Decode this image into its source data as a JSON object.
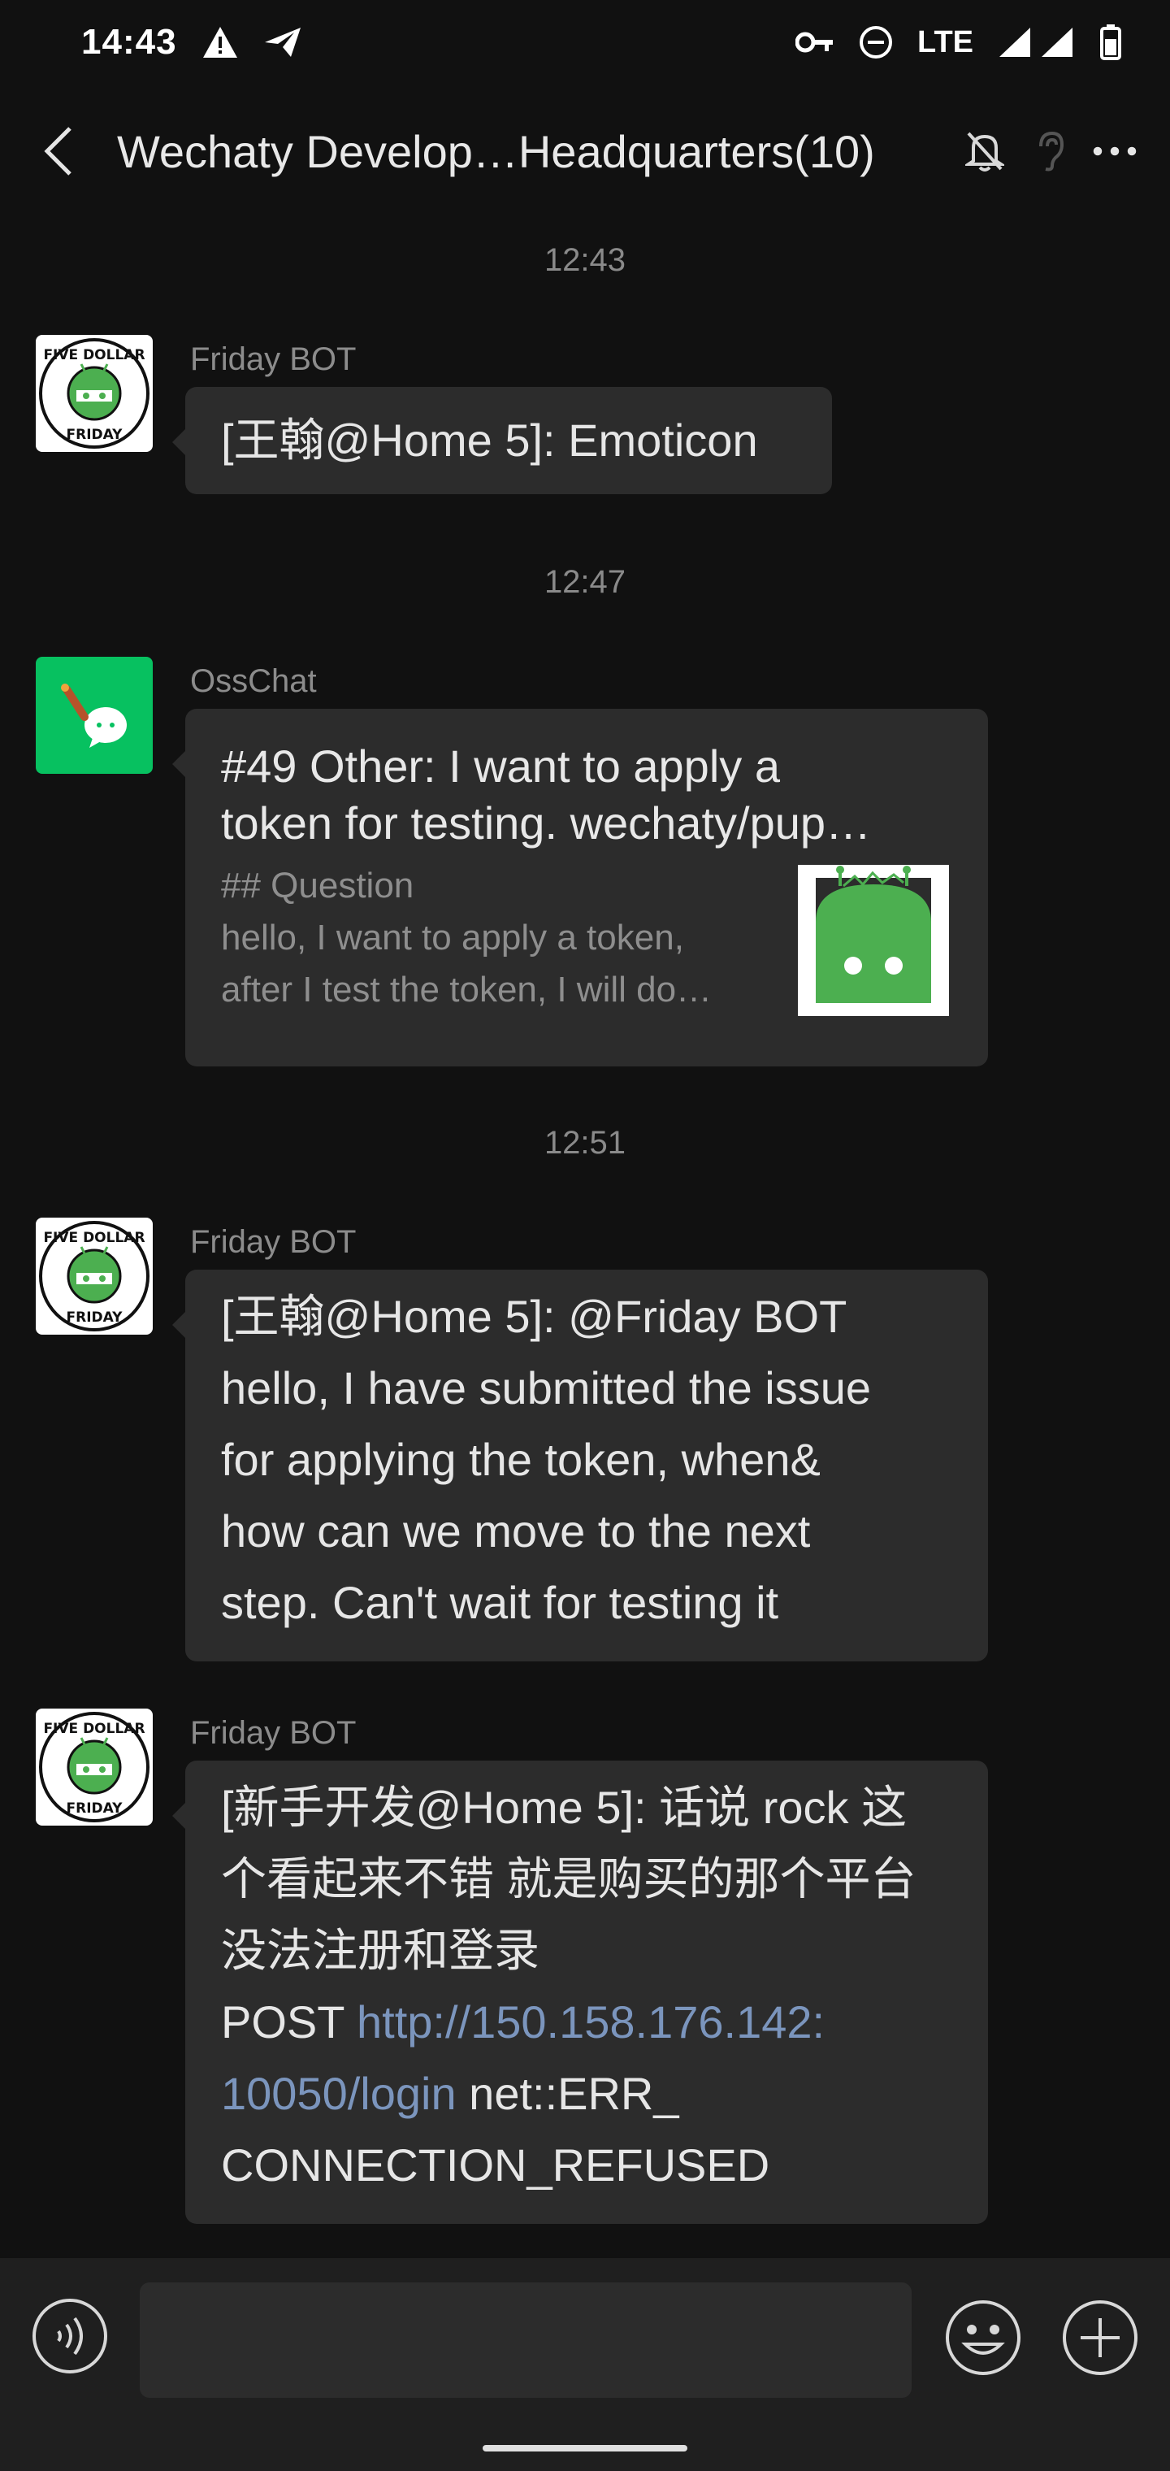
{
  "status_bar": {
    "time": "14:43",
    "network": "LTE",
    "left_icons": [
      "warning-icon",
      "send-icon"
    ],
    "right_icons": [
      "vpn-key-icon",
      "do-not-disturb-icon",
      "signal-icon",
      "battery-icon"
    ]
  },
  "header": {
    "title": "Wechaty Develop…Headquarters(10)",
    "icons": [
      "back-arrow-icon",
      "mute-bell-icon",
      "ear-icon",
      "more-icon"
    ]
  },
  "messages": [
    {
      "type": "timestamp",
      "text": "12:43"
    },
    {
      "type": "text",
      "sender": "Friday BOT",
      "avatar": "five-dollar-friday-avatar",
      "lines": [
        "[王翰@Home 5]: Emoticon"
      ]
    },
    {
      "type": "timestamp",
      "text": "12:47"
    },
    {
      "type": "link_card",
      "sender": "OssChat",
      "avatar": "osschat-avatar",
      "title_lines": [
        "#49 Other:  I want to apply a",
        "token for testing. wechaty/pup…"
      ],
      "heading": "## Question",
      "desc_lines": [
        "hello, I want to apply a token,",
        "after I test the token, I will do…"
      ]
    },
    {
      "type": "timestamp",
      "text": "12:51"
    },
    {
      "type": "text",
      "sender": "Friday BOT",
      "avatar": "five-dollar-friday-avatar",
      "lines": [
        "[王翰@Home 5]: @Friday BOT",
        "hello, I have submitted the issue",
        "for applying the token, when&",
        "how can we move to the next",
        "step.  Can't wait for testing it"
      ]
    },
    {
      "type": "text",
      "sender": "Friday BOT",
      "avatar": "five-dollar-friday-avatar",
      "lines": [
        "[新手开发@Home 5]: 话说 rock 这",
        "个看起来不错 就是购买的那个平台",
        "没法注册和登录"
      ],
      "post_prefix": "POST ",
      "link_line1": "http://150.158.176.142:",
      "link_line2": "10050/login",
      "after_link": " net::ERR_",
      "last_line": "CONNECTION_REFUSED"
    }
  ],
  "avatar_text": {
    "top": "FIVE DOLLAR",
    "bottom": "FRIDAY"
  },
  "input_bar": {
    "placeholder": "",
    "icons": [
      "voice-icon",
      "emoji-icon",
      "plus-icon"
    ]
  },
  "colors": {
    "background": "#111111",
    "bubble": "#2c2c2c",
    "link": "#7b95bd",
    "wechat_green": "#07c160",
    "android_green": "#4caf50"
  }
}
